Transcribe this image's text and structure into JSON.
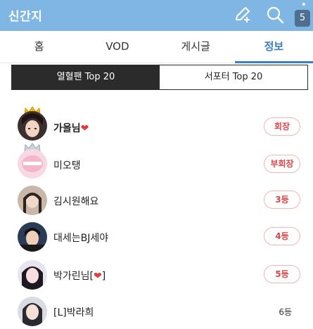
{
  "app": {
    "title": "신간지",
    "badge": "5"
  },
  "header_icons": {
    "edit": "edit-pen-icon",
    "search": "search-icon",
    "menu": "kebab-menu-icon"
  },
  "tabs": [
    {
      "label": "홈"
    },
    {
      "label": "VOD"
    },
    {
      "label": "게시글"
    },
    {
      "label": "정보"
    }
  ],
  "segment": {
    "left": "열혈팬 Top 20",
    "right": "서포터 Top 20"
  },
  "ranking": [
    {
      "name": "가을님",
      "heart": "❤",
      "rank": "회장",
      "crown": "gold"
    },
    {
      "name": "미오탱",
      "heart": "",
      "rank": "부회장",
      "crown": "silver"
    },
    {
      "name": "김시원해요",
      "heart": "",
      "rank": "3등",
      "crown": ""
    },
    {
      "name": "대세는BJ세야",
      "heart": "",
      "rank": "4등",
      "crown": ""
    },
    {
      "name": "박가린님[",
      "heart": "❤",
      "name_suffix": "]",
      "rank": "5등",
      "crown": ""
    },
    {
      "name": "[L]박라희",
      "heart": "",
      "rank": "6등",
      "crown": ""
    }
  ],
  "colors": {
    "header_bg": "#7fb6e3",
    "active_tab": "#3a7fc4",
    "rank_red": "#e04545"
  }
}
